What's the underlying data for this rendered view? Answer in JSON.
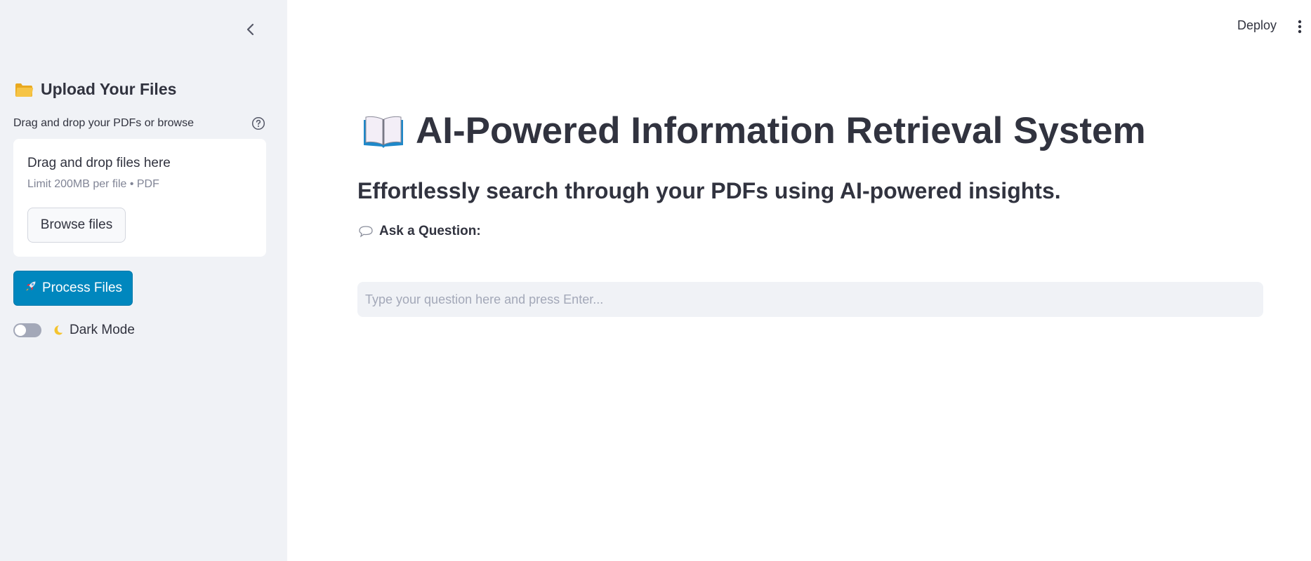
{
  "header": {
    "deploy_label": "Deploy",
    "menu_icon": "kebab-menu-icon"
  },
  "sidebar": {
    "collapse_icon": "chevron-left-icon",
    "title": "Upload Your Files",
    "title_icon": "folder-icon",
    "uploader": {
      "label": "Drag and drop your PDFs or browse",
      "help_icon": "question-circle-icon",
      "drop_title": "Drag and drop files here",
      "limit_text": "Limit 200MB per file • PDF",
      "browse_label": "Browse files"
    },
    "process_button": {
      "icon": "rocket-icon",
      "label": "Process Files",
      "color": "#0087be"
    },
    "dark_mode_toggle": {
      "icon": "moon-icon",
      "label": "Dark Mode",
      "checked": false
    }
  },
  "main": {
    "title_icon": "open-book-icon",
    "title": "AI-Powered Information Retrieval System",
    "subtitle": "Effortlessly search through your PDFs using AI-powered insights.",
    "question": {
      "icon": "speech-bubble-icon",
      "label": "Ask a Question:",
      "value": "",
      "placeholder": "Type your question here and press Enter..."
    }
  },
  "colors": {
    "sidebar_bg": "#f0f2f6",
    "text": "#31333f",
    "accent": "#0087be"
  }
}
